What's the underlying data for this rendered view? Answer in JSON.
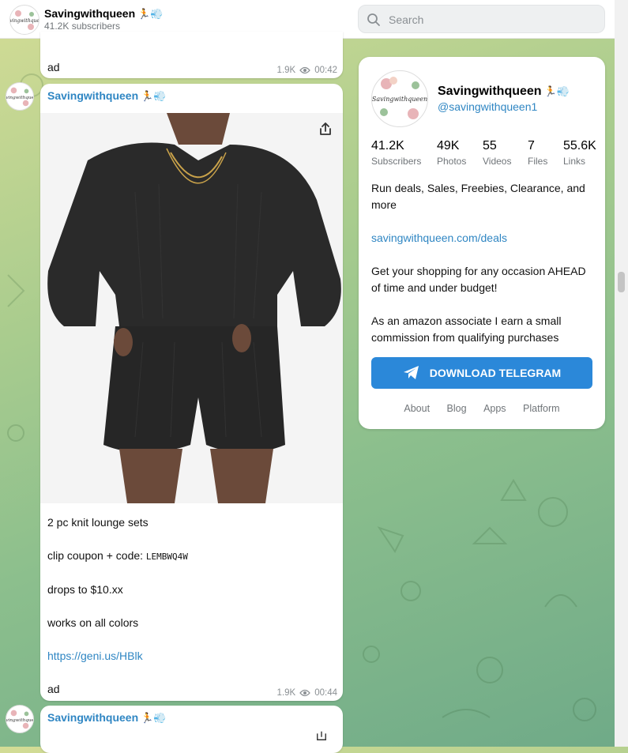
{
  "channel": {
    "name": "Savingwithqueen",
    "name_emoji": "🏃💨",
    "subscribers_short": "41.2K subscribers",
    "handle": "@savingwithqueen1",
    "avatar_text": "Savingwithqueen"
  },
  "search": {
    "placeholder": "Search"
  },
  "messages": [
    {
      "text": "ad",
      "views": "1.9K",
      "time": "00:42"
    },
    {
      "author": "Savingwithqueen",
      "lines": [
        "2 pc knit lounge sets",
        "clip coupon + code:",
        "drops to $10.xx",
        "works on all colors"
      ],
      "coupon_code": "LEMBWQ4W",
      "link": "https://geni.us/HBlk",
      "tag": "ad",
      "views": "1.9K",
      "time": "00:44"
    },
    {
      "author": "Savingwithqueen"
    }
  ],
  "profile": {
    "stats": [
      {
        "value": "41.2K",
        "label": "Subscribers"
      },
      {
        "value": "49K",
        "label": "Photos"
      },
      {
        "value": "55",
        "label": "Videos"
      },
      {
        "value": "7",
        "label": "Files"
      },
      {
        "value": "55.6K",
        "label": "Links"
      }
    ],
    "description": [
      "Run deals, Sales, Freebies, Clearance, and more",
      "savingwithqueen.com/deals",
      "Get your shopping for any occasion AHEAD of time and under budget!",
      "As an amazon associate I earn a small commission from qualifying purchases"
    ],
    "download_label": "DOWNLOAD TELEGRAM",
    "footer_links": [
      "About",
      "Blog",
      "Apps",
      "Platform"
    ]
  },
  "colors": {
    "accent": "#2f86c3",
    "button": "#2b88d9",
    "muted": "#707579"
  }
}
